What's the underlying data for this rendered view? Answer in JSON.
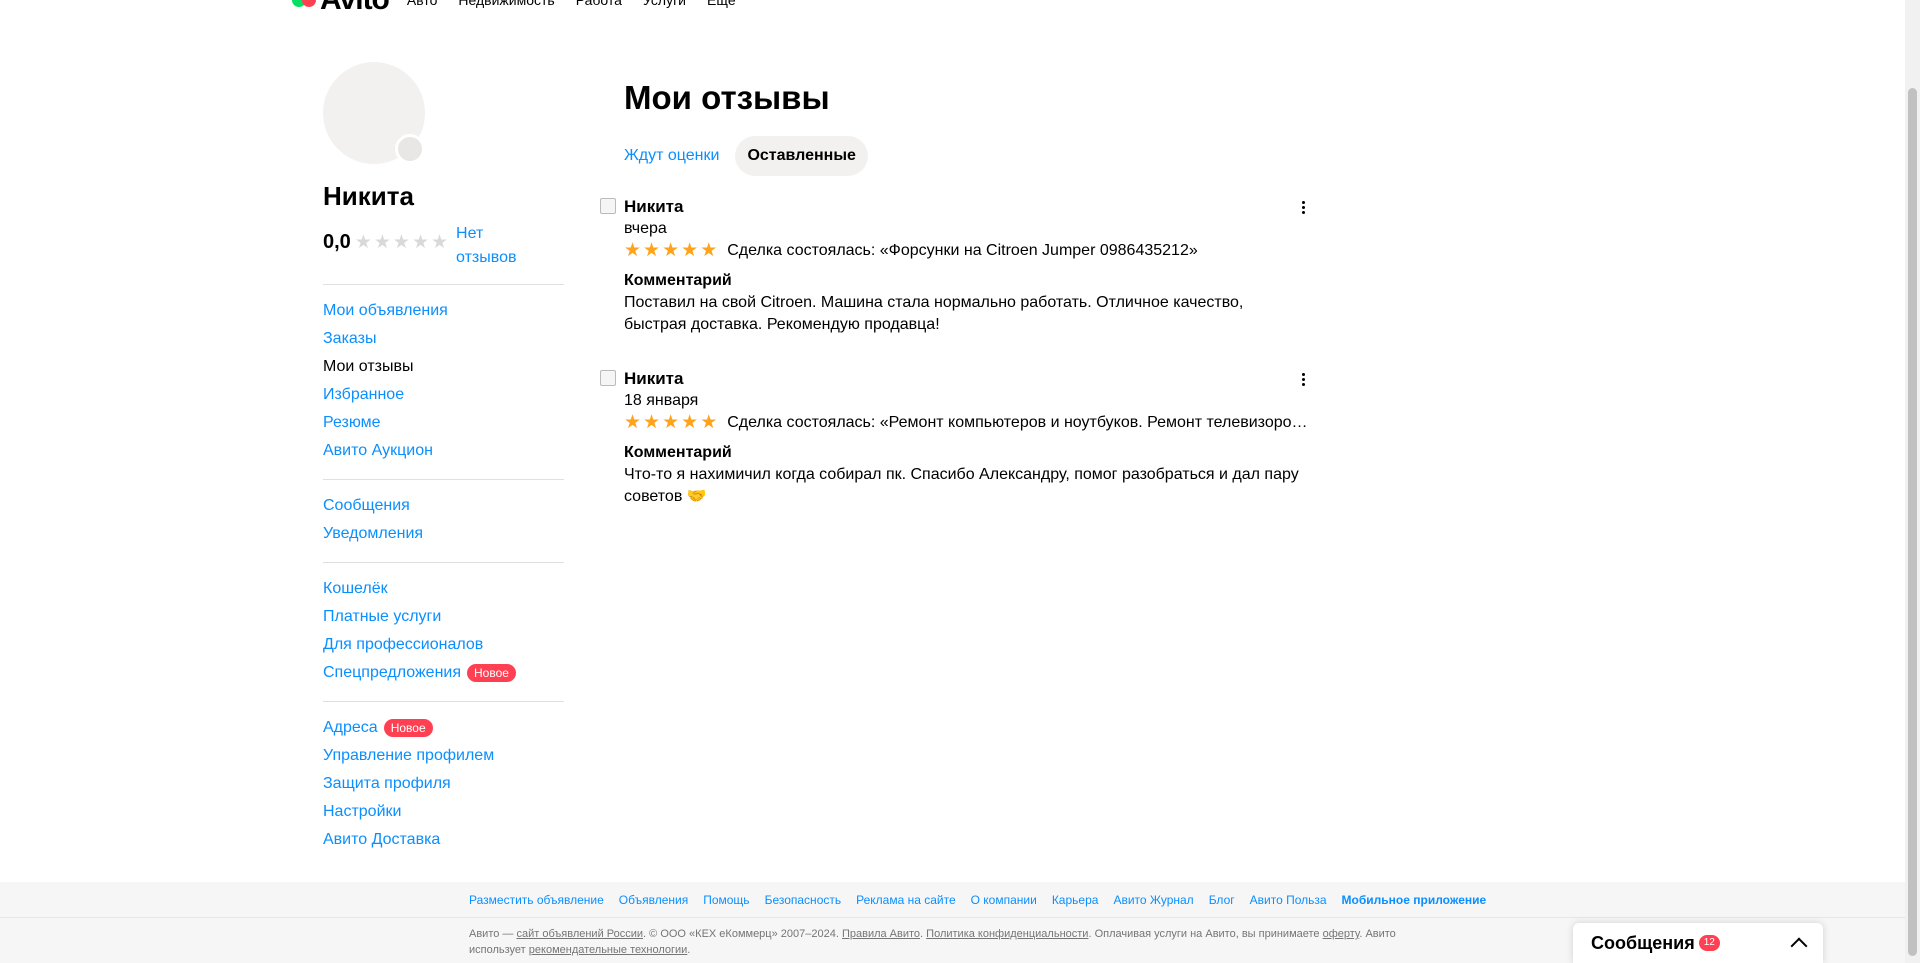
{
  "topnav": {
    "logo_text": "Avito",
    "links": [
      "Авто",
      "Недвижимость",
      "Работа",
      "Услуги",
      "Ещё"
    ]
  },
  "sidebar": {
    "name": "Никита",
    "rating": "0,0",
    "no_reviews": "Нет отзывов",
    "group1": [
      "Мои объявления",
      "Заказы",
      "Мои отзывы",
      "Избранное",
      "Резюме",
      "Авито Аукцион"
    ],
    "group2": [
      "Сообщения",
      "Уведомления"
    ],
    "group3": [
      "Кошелёк",
      "Платные услуги",
      "Для профессионалов",
      "Спецпредложения"
    ],
    "group4": [
      "Адреса",
      "Управление профилем",
      "Защита профиля",
      "Настройки",
      "Авито Доставка"
    ],
    "new_badge": "Новое"
  },
  "main": {
    "title": "Мои отзывы",
    "tabs": [
      "Ждут оценки",
      "Оставленные"
    ],
    "comment_label": "Комментарий",
    "reviews": [
      {
        "author": "Никита",
        "date": "вчера",
        "deal": "Сделка состоялась: «Форсунки на Citroen Jumper 0986435212»",
        "comment": "Поставил на свой Citroen. Машина стала нормально работать. Отличное качество, быстрая доставка. Рекомендую продавца!"
      },
      {
        "author": "Никита",
        "date": "18 января",
        "deal": "Сделка состоялась: «Ремонт компьютеров и ноутбуков. Ремонт телевизоро…",
        "comment": "Что-то я нахимичил когда собирал пк. Спасибо Александру, помог разобраться и дал пару советов 🤝"
      }
    ]
  },
  "footer": {
    "links": [
      "Разместить объявление",
      "Объявления",
      "Помощь",
      "Безопасность",
      "Реклама на сайте",
      "О компании",
      "Карьера",
      "Авито Журнал",
      "Блог",
      "Авито Польза",
      "Мобильное приложение"
    ],
    "legal_1": "Авито — ",
    "legal_link1": "сайт объявлений России",
    "legal_2": ". © ООО «КЕХ еКоммерц» 2007–2024. ",
    "legal_link2": "Правила Авито",
    "legal_3": ". ",
    "legal_link3": "Политика конфиденциальности",
    "legal_4": ". Оплачивая услуги на Авито, вы принимаете ",
    "legal_link4": "оферту",
    "legal_5": ". Авито использует ",
    "legal_link5": "рекомендательные технологии",
    "legal_6": "."
  },
  "messages_widget": {
    "title": "Сообщения",
    "count": "12"
  },
  "colors": {
    "link": "#0a8fff",
    "badge": "#ff4053",
    "star_gold": "#ffa31a",
    "star_grey": "#d9d9d9"
  }
}
